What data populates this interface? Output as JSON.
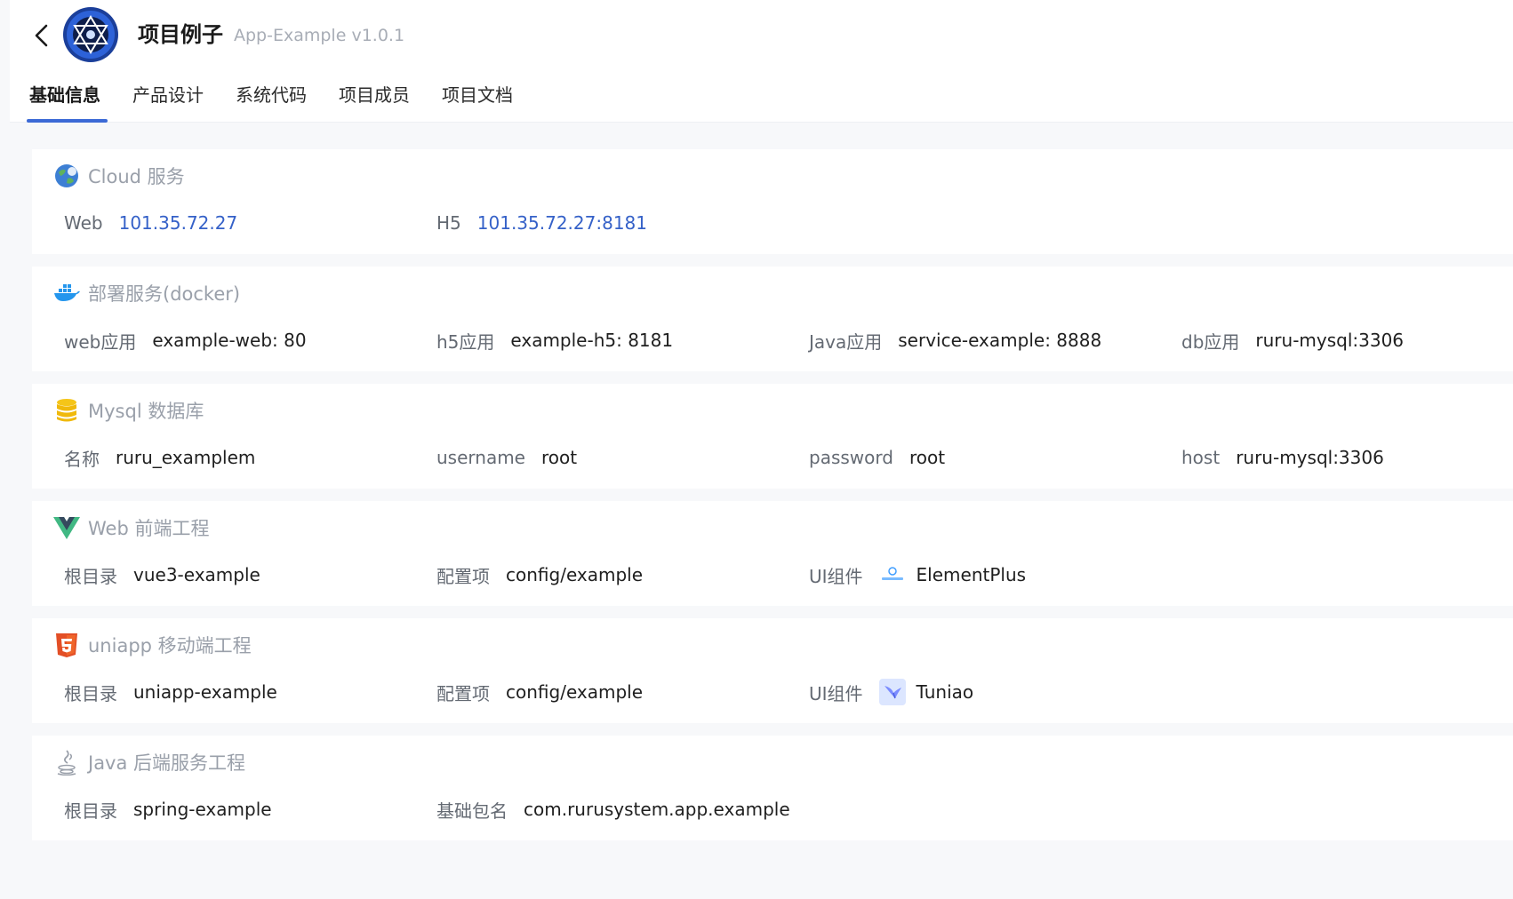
{
  "header": {
    "title": "项目例子",
    "subtitle": "App-Example v1.0.1"
  },
  "tabs": [
    {
      "label": "基础信息",
      "active": true
    },
    {
      "label": "产品设计",
      "active": false
    },
    {
      "label": "系统代码",
      "active": false
    },
    {
      "label": "项目成员",
      "active": false
    },
    {
      "label": "项目文档",
      "active": false
    }
  ],
  "sections": [
    {
      "icon": "cloud-globe-icon",
      "title": "Cloud 服务",
      "fields": [
        {
          "label": "Web",
          "value": "101.35.72.27"
        },
        {
          "label": "H5",
          "value": "101.35.72.27:8181"
        }
      ]
    },
    {
      "icon": "docker-icon",
      "title": "部署服务(docker)",
      "fields": [
        {
          "label": "web应用",
          "value": "example-web: 80"
        },
        {
          "label": "h5应用",
          "value": "example-h5: 8181"
        },
        {
          "label": "Java应用",
          "value": "service-example: 8888"
        },
        {
          "label": "db应用",
          "value": "ruru-mysql:3306"
        }
      ]
    },
    {
      "icon": "database-icon",
      "title": "Mysql 数据库",
      "fields": [
        {
          "label": "名称",
          "value": "ruru_examplem"
        },
        {
          "label": "username",
          "value": "root"
        },
        {
          "label": "password",
          "value": "root"
        },
        {
          "label": "host",
          "value": "ruru-mysql:3306"
        }
      ]
    },
    {
      "icon": "vue-icon",
      "title": "Web 前端工程",
      "fields": [
        {
          "label": "根目录",
          "value": "vue3-example"
        },
        {
          "label": "配置项",
          "value": "config/example"
        },
        {
          "label": "UI组件",
          "value": "ElementPlus",
          "ui_icon": "element-plus-icon"
        }
      ]
    },
    {
      "icon": "html5-icon",
      "title": "uniapp 移动端工程",
      "fields": [
        {
          "label": "根目录",
          "value": "uniapp-example"
        },
        {
          "label": "配置项",
          "value": "config/example"
        },
        {
          "label": "UI组件",
          "value": "Tuniao",
          "ui_icon": "tuniao-bird-icon"
        }
      ]
    },
    {
      "icon": "java-icon",
      "title": "Java 后端服务工程",
      "fields": [
        {
          "label": "根目录",
          "value": "spring-example"
        },
        {
          "label": "基础包名",
          "value": "com.rurusystem.app.example"
        }
      ]
    }
  ],
  "colors": {
    "accent": "#3c6ad6",
    "link": "#3561c8",
    "section_title": "#9aa0aa",
    "label": "#646a73"
  }
}
